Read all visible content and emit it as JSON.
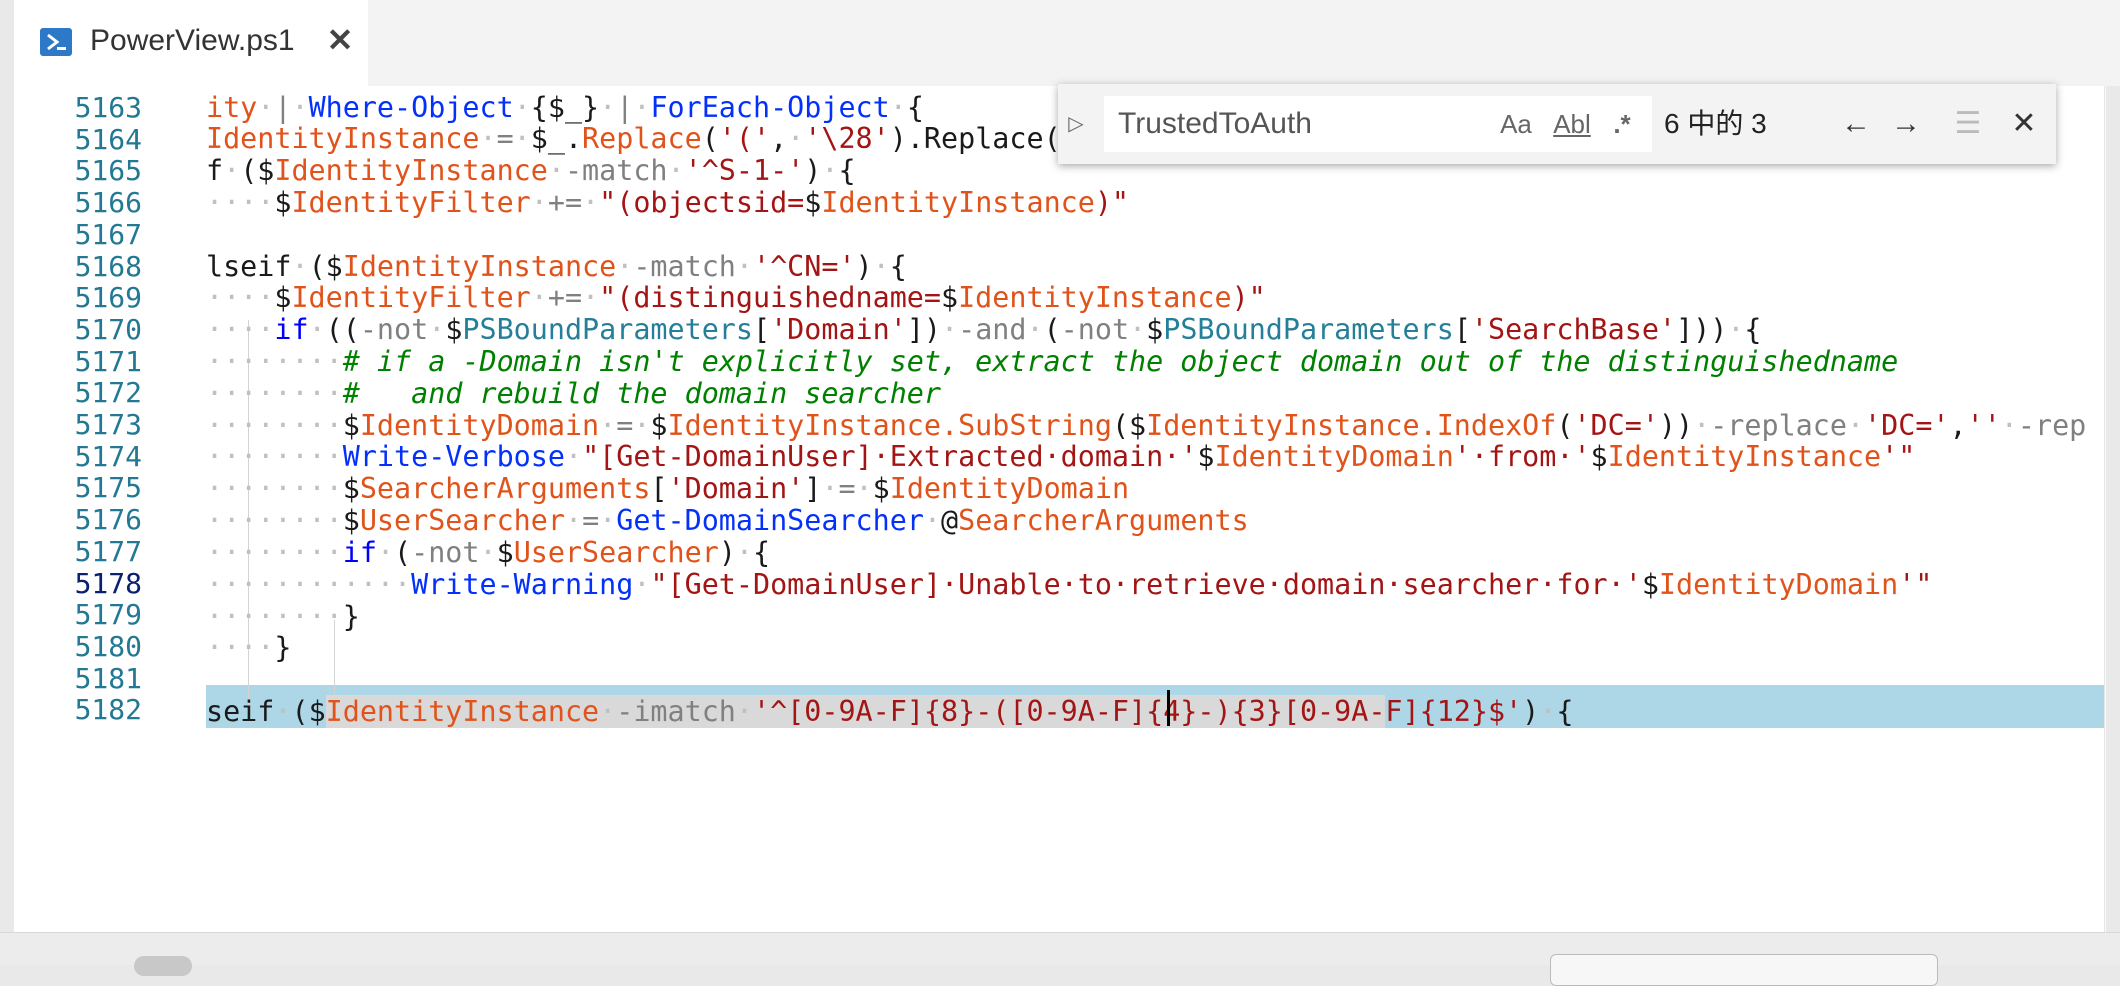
{
  "tab": {
    "title": "PowerView.ps1",
    "close_glyph": "✕",
    "icon": "powershell-icon"
  },
  "find": {
    "toggle_glyph": "▷",
    "query": "TrustedToAuth",
    "match_case": "Aa",
    "whole_word": "Abl",
    "regex": ".*",
    "count": "6 中的 3",
    "prev_glyph": "←",
    "next_glyph": "→",
    "selection_glyph": "☰",
    "close_glyph": "✕"
  },
  "editor": {
    "line_numbers": [
      "5163",
      "5164",
      "5165",
      "5166",
      "5167",
      "5168",
      "5169",
      "5170",
      "5171",
      "5172",
      "5173",
      "5174",
      "5175",
      "5176",
      "5177",
      "5178",
      "5179",
      "5180",
      "5181",
      "5182"
    ],
    "active_line": "5178",
    "lines": [
      "ity | Where-Object {$_} | ForEach-Object {",
      "IdentityInstance = $_.Replace('(', '\\28').Replace(",
      "f ($IdentityInstance -match '^S-1-') {",
      "    $IdentityFilter += \"(objectsid=$IdentityInstance)\"",
      "",
      "lseif ($IdentityInstance -match '^CN=') {",
      "    $IdentityFilter += \"(distinguishedname=$IdentityInstance)\"",
      "    if ((-not $PSBoundParameters['Domain']) -and (-not $PSBoundParameters['SearchBase'])) {",
      "        # if a -Domain isn't explicitly set, extract the object domain out of the distinguishedname",
      "        #   and rebuild the domain searcher",
      "        $IdentityDomain = $IdentityInstance.SubString($IdentityInstance.IndexOf('DC=')) -replace 'DC=','' -rep",
      "        Write-Verbose \"[Get-DomainUser] Extracted domain '$IdentityDomain' from '$IdentityInstance'\"",
      "        $SearcherArguments['Domain'] = $IdentityDomain",
      "        $UserSearcher = Get-DomainSearcher @SearcherArguments",
      "        if (-not $UserSearcher) {",
      "            Write-Warning \"[Get-DomainUser] Unable to retrieve domain searcher for '$IdentityDomain'\"",
      "        }",
      "    }",
      "",
      "seif ($IdentityInstance -imatch '^[0-9A-F]{8}-([0-9A-F]{4}-){3}[0-9A-F]{12}$') {"
    ]
  },
  "colors": {
    "line_highlight": "#add6e6",
    "variable": "#e0531a",
    "cmdlet": "#0431fa",
    "string": "#a31515",
    "comment": "#008000",
    "teal": "#267f99"
  }
}
